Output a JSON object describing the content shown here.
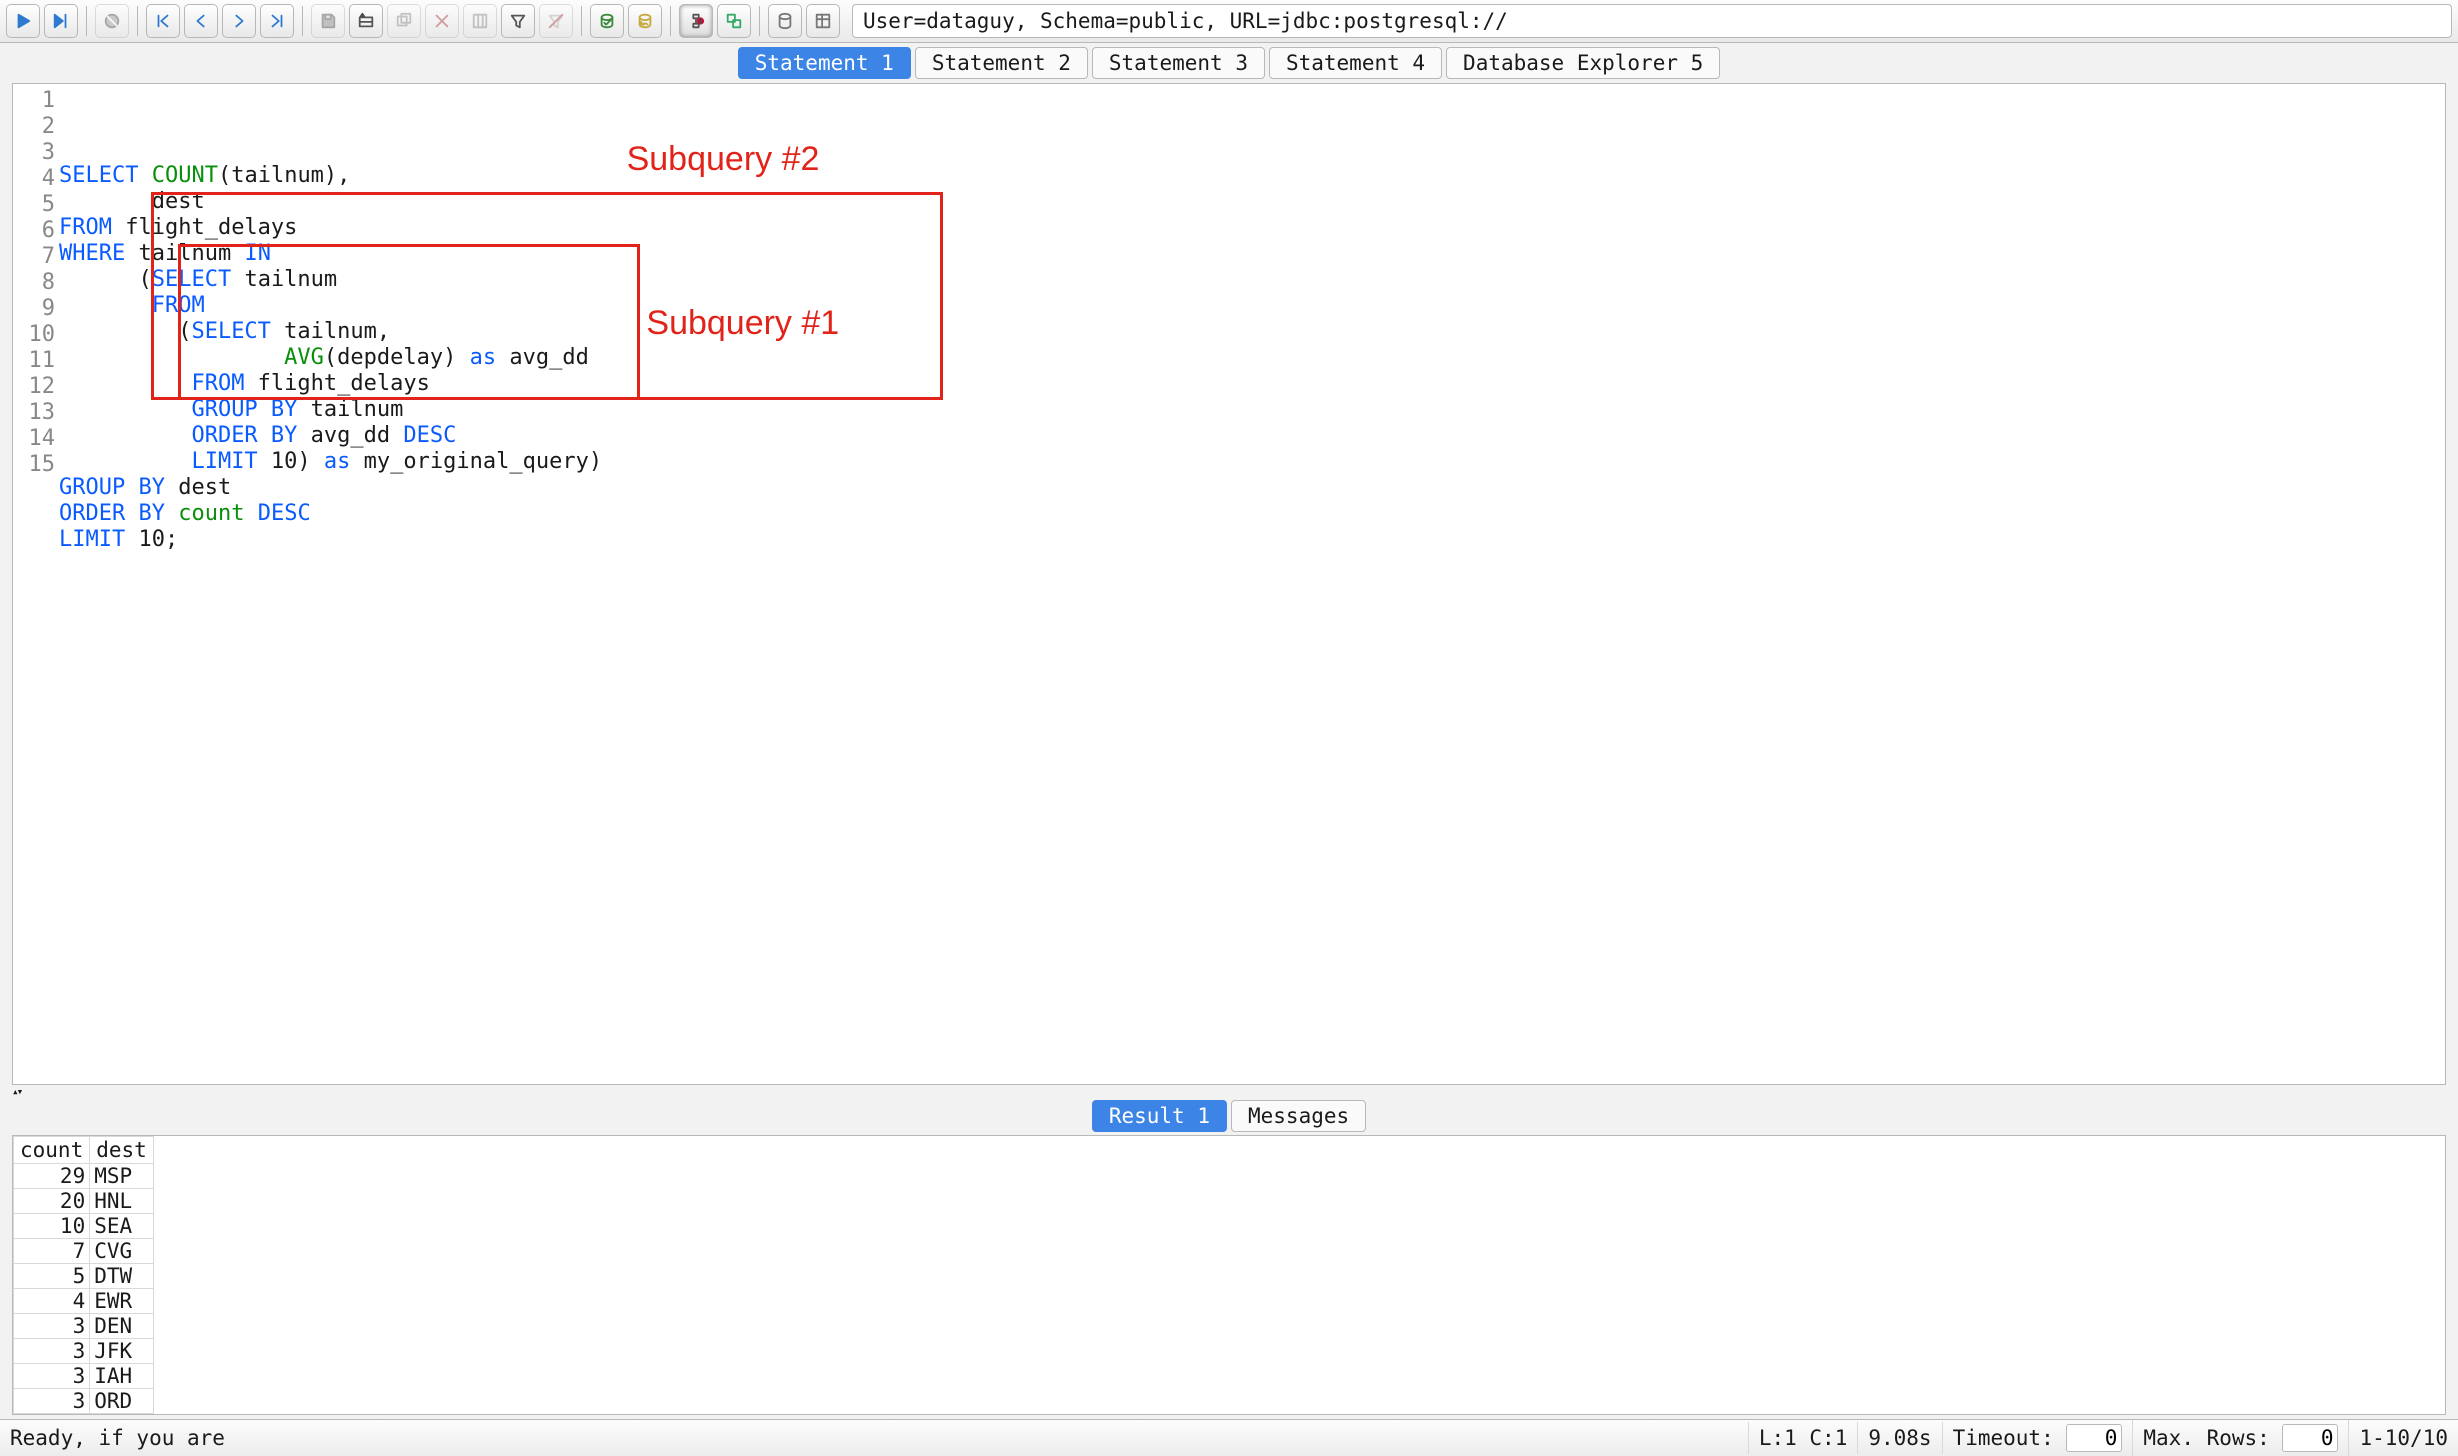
{
  "connection_string": "User=dataguy, Schema=public, URL=jdbc:postgresql://",
  "tabs": {
    "items": [
      {
        "label": "Statement 1",
        "active": true
      },
      {
        "label": "Statement 2",
        "active": false
      },
      {
        "label": "Statement 3",
        "active": false
      },
      {
        "label": "Statement 4",
        "active": false
      },
      {
        "label": "Database Explorer 5",
        "active": false
      }
    ]
  },
  "editor": {
    "lines": [
      [
        {
          "t": "SELECT",
          "c": "kw"
        },
        {
          "t": " "
        },
        {
          "t": "COUNT",
          "c": "fn"
        },
        {
          "t": "(tailnum),"
        }
      ],
      [
        {
          "t": "       dest"
        }
      ],
      [
        {
          "t": "FROM",
          "c": "kw"
        },
        {
          "t": " flight_delays"
        }
      ],
      [
        {
          "t": "WHERE",
          "c": "kw"
        },
        {
          "t": " tailnum "
        },
        {
          "t": "IN",
          "c": "kw"
        }
      ],
      [
        {
          "t": "      ("
        },
        {
          "t": "SELECT",
          "c": "kw"
        },
        {
          "t": " tailnum"
        }
      ],
      [
        {
          "t": "       "
        },
        {
          "t": "FROM",
          "c": "kw"
        }
      ],
      [
        {
          "t": "         ("
        },
        {
          "t": "SELECT",
          "c": "kw"
        },
        {
          "t": " tailnum,"
        }
      ],
      [
        {
          "t": "                 "
        },
        {
          "t": "AVG",
          "c": "fn"
        },
        {
          "t": "(depdelay) "
        },
        {
          "t": "as",
          "c": "kw"
        },
        {
          "t": " avg_dd"
        }
      ],
      [
        {
          "t": "          "
        },
        {
          "t": "FROM",
          "c": "kw"
        },
        {
          "t": " flight_delays"
        }
      ],
      [
        {
          "t": "          "
        },
        {
          "t": "GROUP BY",
          "c": "kw"
        },
        {
          "t": " tailnum"
        }
      ],
      [
        {
          "t": "          "
        },
        {
          "t": "ORDER BY",
          "c": "kw"
        },
        {
          "t": " avg_dd "
        },
        {
          "t": "DESC",
          "c": "kw"
        }
      ],
      [
        {
          "t": "          "
        },
        {
          "t": "LIMIT",
          "c": "kw"
        },
        {
          "t": " 10) "
        },
        {
          "t": "as",
          "c": "kw"
        },
        {
          "t": " my_original_query)"
        }
      ],
      [
        {
          "t": "GROUP BY",
          "c": "kw"
        },
        {
          "t": " dest"
        }
      ],
      [
        {
          "t": "ORDER BY",
          "c": "kw"
        },
        {
          "t": " "
        },
        {
          "t": "count",
          "c": "fn"
        },
        {
          "t": " "
        },
        {
          "t": "DESC",
          "c": "kw"
        }
      ],
      [
        {
          "t": "LIMIT",
          "c": "kw"
        },
        {
          "t": " 10;"
        }
      ]
    ],
    "annotations": {
      "sub2_label": "Subquery #2",
      "sub1_label": "Subquery #1"
    }
  },
  "result_tabs": {
    "items": [
      {
        "label": "Result 1",
        "active": true
      },
      {
        "label": "Messages",
        "active": false
      }
    ]
  },
  "results": {
    "headers": [
      "count",
      "dest"
    ],
    "rows": [
      {
        "count": 29,
        "dest": "MSP"
      },
      {
        "count": 20,
        "dest": "HNL"
      },
      {
        "count": 10,
        "dest": "SEA"
      },
      {
        "count": 7,
        "dest": "CVG"
      },
      {
        "count": 5,
        "dest": "DTW"
      },
      {
        "count": 4,
        "dest": "EWR"
      },
      {
        "count": 3,
        "dest": "DEN"
      },
      {
        "count": 3,
        "dest": "JFK"
      },
      {
        "count": 3,
        "dest": "IAH"
      },
      {
        "count": 3,
        "dest": "ORD"
      }
    ]
  },
  "status": {
    "message": "Ready, if you are",
    "position": "L:1 C:1",
    "exec_time": "9.08s",
    "timeout_label": "Timeout:",
    "timeout_value": "0",
    "maxrows_label": "Max. Rows:",
    "maxrows_value": "0",
    "row_range": "1-10/10"
  },
  "icons": {
    "run": "run-icon",
    "run_to_cursor": "run-current-icon",
    "stop": "stop-icon",
    "first": "first-record-icon",
    "prev": "prev-record-icon",
    "next": "next-record-icon",
    "last": "last-record-icon",
    "save": "save-icon",
    "insert": "insert-row-icon",
    "copy": "copy-row-icon",
    "delete": "delete-row-icon",
    "filter": "filter-icon",
    "funnel": "funnel-icon",
    "clearfilt": "clear-filter-icon",
    "commit": "commit-icon",
    "rollback": "rollback-icon",
    "reconnect": "reconnect-icon",
    "append": "append-results-icon",
    "db": "database-icon",
    "dbexp": "db-explorer-icon"
  }
}
